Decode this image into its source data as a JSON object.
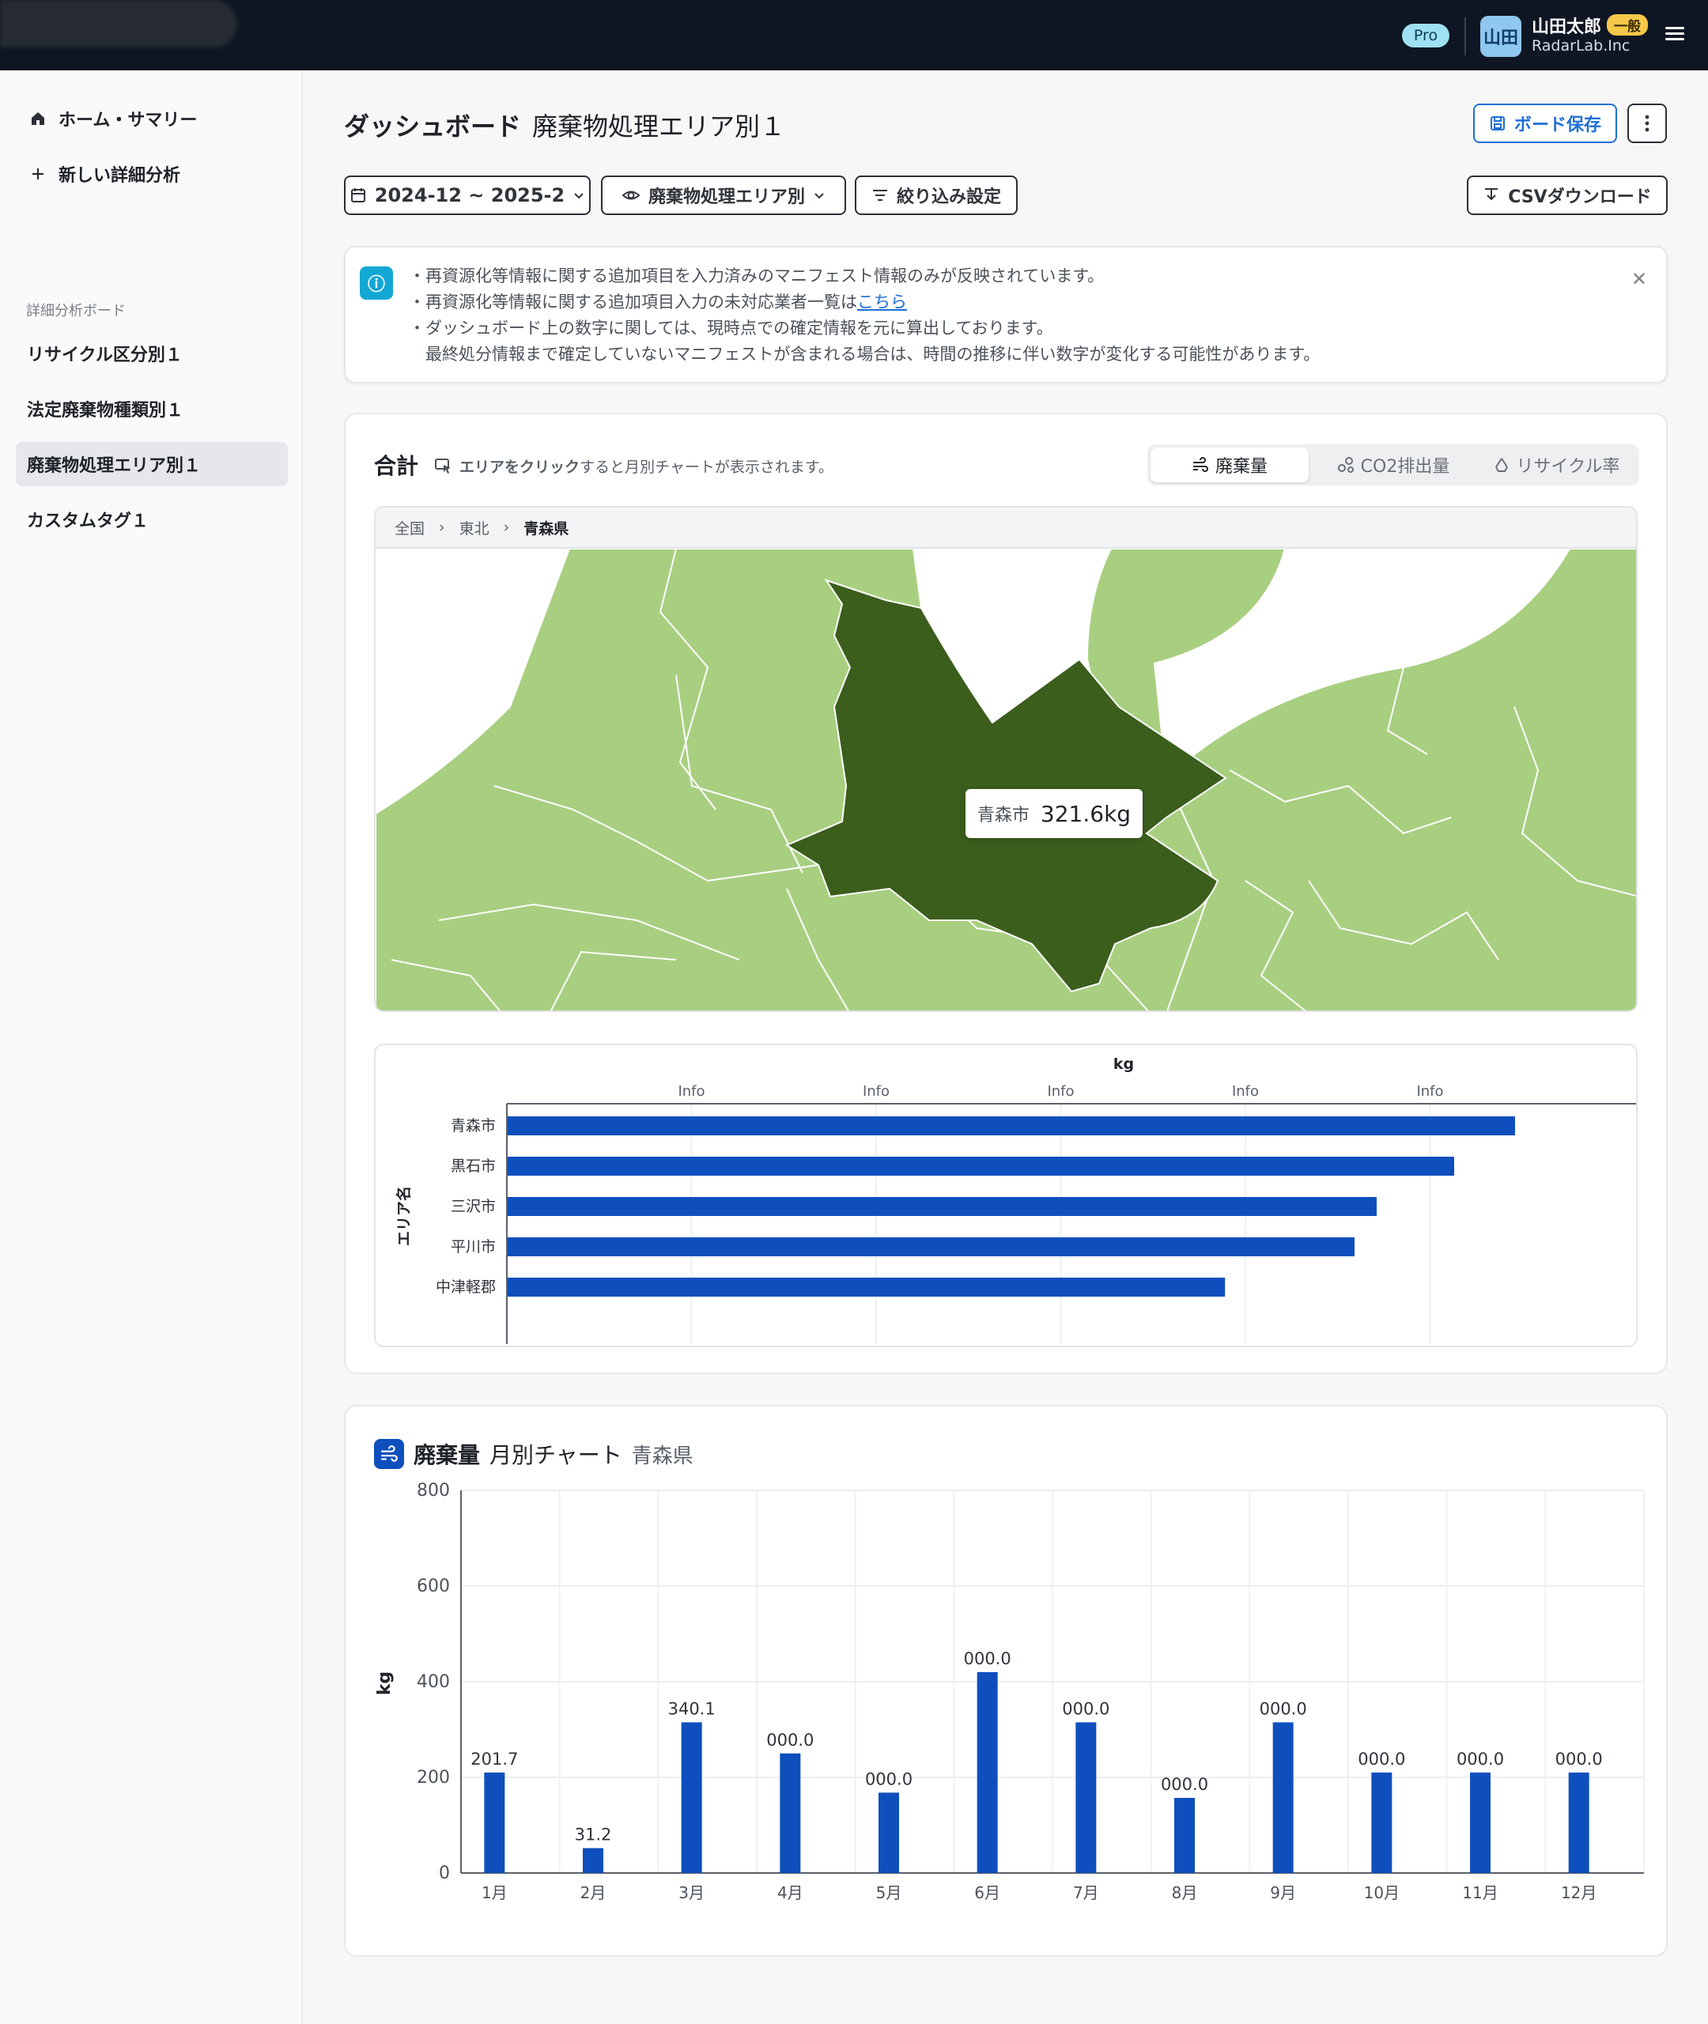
{
  "header": {
    "plan_badge": "Pro",
    "avatar_text": "山田",
    "user_name": "山田太郎",
    "role": "一般",
    "org": "RadarLab.Inc"
  },
  "sidebar": {
    "home": "ホーム・サマリー",
    "new_analysis": "新しい詳細分析",
    "section_label": "詳細分析ボード",
    "boards": [
      "リサイクル区分別１",
      "法定廃棄物種類別１",
      "廃棄物処理エリア別１",
      "カスタムタグ１"
    ],
    "active_index": 2
  },
  "page": {
    "title": "ダッシュボード",
    "subtitle": "廃棄物処理エリア別１",
    "save_label": "ボード保存",
    "date_range": "2024-12 ~ 2025-2",
    "view_label": "廃棄物処理エリア別",
    "filter_label": "絞り込み設定",
    "csv_label": "CSVダウンロード"
  },
  "info": {
    "line1": "・再資源化等情報に関する追加項目を入力済みのマニフェスト情報のみが反映されています。",
    "line2_prefix": "・再資源化等情報に関する追加項目入力の未対応業者一覧は",
    "line2_link": "こちら",
    "line3": "・ダッシュボード上の数字に関しては、現時点での確定情報を元に算出しております。",
    "line4": "　最終処分情報まで確定していないマニフェストが含まれる場合は、時間の推移に伴い数字が変化する可能性があります。"
  },
  "total_card": {
    "title": "合計",
    "hint_bold": "エリアをクリック",
    "hint_rest": "すると月別チャートが表示されます。",
    "tabs": [
      "廃棄量",
      "CO2排出量",
      "リサイクル率"
    ],
    "active_tab": 0,
    "breadcrumb": [
      "全国",
      "東北",
      "青森県"
    ],
    "tooltip_name": "青森市",
    "tooltip_value": "321.6kg",
    "colors": {
      "map_light": "#a8cf80",
      "map_dark": "#3b5e1c",
      "bar": "#0f4fbd"
    }
  },
  "chart_data": [
    {
      "type": "bar",
      "orientation": "horizontal",
      "title": "",
      "xlabel": "kg",
      "ylabel": "エリア名",
      "x_tick_labels": [
        "Info",
        "Info",
        "Info",
        "Info",
        "Info"
      ],
      "categories": [
        "青森市",
        "黒石市",
        "三沢市",
        "平川市",
        "中津軽郡"
      ],
      "values": [
        0.91,
        0.855,
        0.785,
        0.765,
        0.648
      ],
      "value_unit": "fraction of axis width"
    },
    {
      "type": "bar",
      "title": "廃棄量 月別チャート 青森県",
      "title_bold": "廃棄量",
      "title_rest": "月別チャート",
      "title_region": "青森県",
      "xlabel": "",
      "ylabel": "kg",
      "ylim": [
        0,
        800
      ],
      "yticks": [
        0,
        200,
        400,
        600,
        800
      ],
      "categories": [
        "1月",
        "2月",
        "3月",
        "4月",
        "5月",
        "6月",
        "7月",
        "8月",
        "9月",
        "10月",
        "11月",
        "12月"
      ],
      "values": [
        210,
        52,
        315,
        250,
        168,
        420,
        315,
        157,
        315,
        210,
        210,
        210
      ],
      "data_labels": [
        "201.7",
        "31.2",
        "340.1",
        "000.0",
        "000.0",
        "000.0",
        "000.0",
        "000.0",
        "000.0",
        "000.0",
        "000.0",
        "000.0"
      ]
    }
  ]
}
